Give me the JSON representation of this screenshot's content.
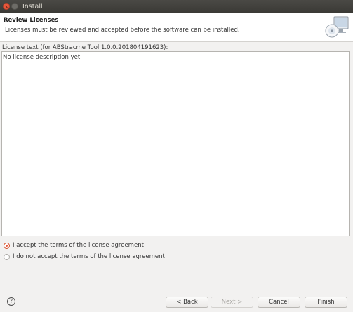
{
  "window": {
    "title": "Install"
  },
  "header": {
    "title": "Review Licenses",
    "message": "Licenses must be reviewed and accepted before the software can be installed.",
    "icon": "install-computer-icon"
  },
  "license": {
    "label": "License text (for ABStracme Tool 1.0.0.201804191623):",
    "text": "No license description yet"
  },
  "options": {
    "accept": {
      "label": "I accept the terms of the license agreement",
      "selected": true
    },
    "decline": {
      "label": "I do not accept the terms of the license agreement",
      "selected": false
    }
  },
  "buttons": {
    "help": "?",
    "back": "< Back",
    "next": "Next >",
    "cancel": "Cancel",
    "finish": "Finish"
  },
  "colors": {
    "accent": "#e9573b",
    "titlebar": "#3c3b37"
  }
}
